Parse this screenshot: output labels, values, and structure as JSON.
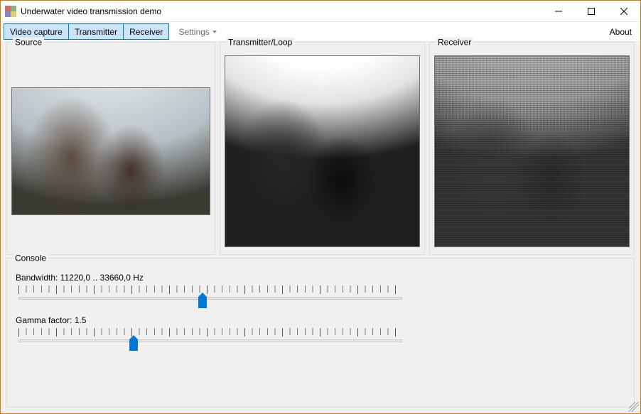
{
  "window": {
    "title": "Underwater video transmission demo"
  },
  "toolbar": {
    "video_capture": "Video capture",
    "transmitter": "Transmitter",
    "receiver": "Receiver",
    "settings": "Settings",
    "about": "About"
  },
  "panels": {
    "source_title": "Source",
    "transmitter_title": "Transmitter/Loop",
    "receiver_title": "Receiver"
  },
  "console": {
    "title": "Console",
    "bandwidth": {
      "label": "Bandwidth: 11220,0 .. 33660,0 Hz",
      "low": "11220,0",
      "high": "33660,0",
      "unit": "Hz",
      "thumb_percent": 48
    },
    "gamma": {
      "label": "Gamma factor: 1.5",
      "value": "1.5",
      "thumb_percent": 30
    }
  }
}
